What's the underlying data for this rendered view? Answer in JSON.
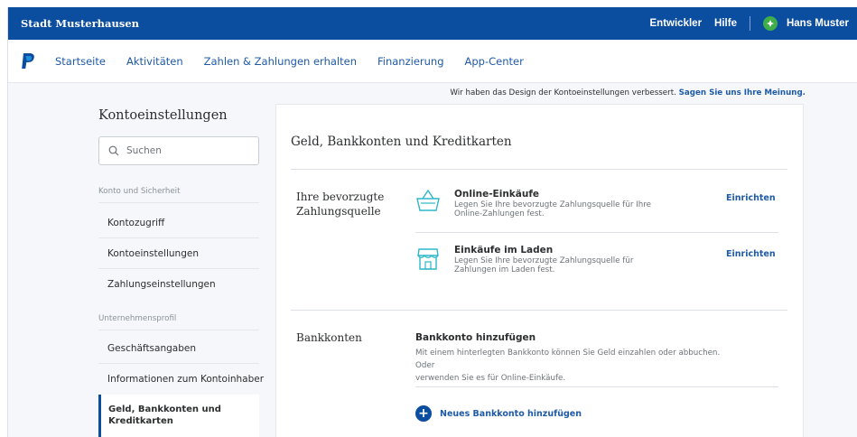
{
  "topbar": {
    "brand": "Stadt Musterhausen",
    "links": [
      "Entwickler",
      "Hilfe"
    ],
    "user": "Hans Muster"
  },
  "nav": {
    "items": [
      "Startseite",
      "Aktivitäten",
      "Zahlen & Zahlungen erhalten",
      "Finanzierung",
      "App-Center"
    ]
  },
  "notice": {
    "text": "Wir haben das Design der Kontoeinstellungen verbessert.",
    "link": "Sagen Sie uns Ihre Meinung."
  },
  "sidebar": {
    "title": "Kontoeinstellungen",
    "search_placeholder": "Suchen",
    "section1": "Konto und Sicherheit",
    "section1_items": [
      "Kontozugriff",
      "Kontoeinstellungen",
      "Zahlungseinstellungen"
    ],
    "section2": "Unternehmensprofil",
    "section2_items": [
      "Geschäftsangaben",
      "Informationen zum Kontoinhaber"
    ],
    "active_item": "Geld, Bankkonten und Kreditkarten"
  },
  "main": {
    "title": "Geld, Bankkonten und Kreditkarten",
    "pref_label_1": "Ihre bevorzugte",
    "pref_label_2": "Zahlungsquelle",
    "options": [
      {
        "title": "Online-Einkäufe",
        "desc_1": "Legen Sie Ihre bevorzugte Zahlungsquelle für Ihre",
        "desc_2": "Online-Zahlungen fest.",
        "action": "Einrichten",
        "icon": "shopping-basket-icon"
      },
      {
        "title": "Einkäufe im Laden",
        "desc_1": "Legen Sie Ihre bevorzugte Zahlungsquelle für",
        "desc_2": "Zahlungen im Laden fest.",
        "action": "Einrichten",
        "icon": "storefront-icon"
      }
    ],
    "bank_label": "Bankkonten",
    "bank_title": "Bankkonto hinzufügen",
    "bank_desc_1": "Mit einem hinterlegten Bankkonto können Sie Geld einzahlen oder abbuchen. Oder",
    "bank_desc_2": "verwenden Sie es für Online-Einkäufe.",
    "add_bank": "Neues Bankkonto hinzufügen"
  },
  "colors": {
    "brand_blue": "#0b4d9e",
    "link_blue": "#1f5aa6",
    "icon_teal": "#2eb8c8",
    "avatar_green": "#3fae48"
  }
}
